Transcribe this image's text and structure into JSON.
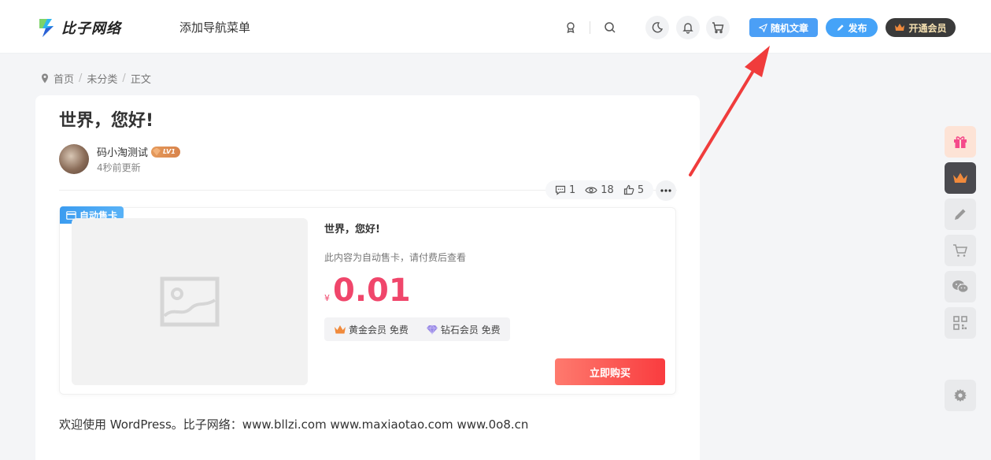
{
  "header": {
    "logo_text": "比子网络",
    "nav_menu": "添加导航菜单",
    "random_label": "随机文章",
    "publish_label": "发布",
    "vip_label": "开通会员"
  },
  "breadcrumb": {
    "home": "首页",
    "category": "未分类",
    "current": "正文",
    "sep": "/"
  },
  "article": {
    "title": "世界，您好!",
    "author": "码小淘测试",
    "level": "LV1",
    "updated": "4秒前更新",
    "comments": "1",
    "views": "18",
    "likes": "5",
    "content": "欢迎使用 WordPress。比子网络：www.bllzi.com www.maxiaotao.com www.0o8.cn"
  },
  "product": {
    "tag": "自动售卡",
    "title": "世界，您好!",
    "desc": "此内容为自动售卡，请付费后查看",
    "currency": "¥",
    "price": "0.01",
    "gold_perk": "黄金会员 免费",
    "diamond_perk": "钻石会员 免费",
    "buy_label": "立即购买"
  },
  "colors": {
    "accent_blue": "#4b9ff6",
    "price_red": "#f0466b",
    "buy_red": "#f93c3f",
    "arrow_red": "#f03c3c"
  }
}
